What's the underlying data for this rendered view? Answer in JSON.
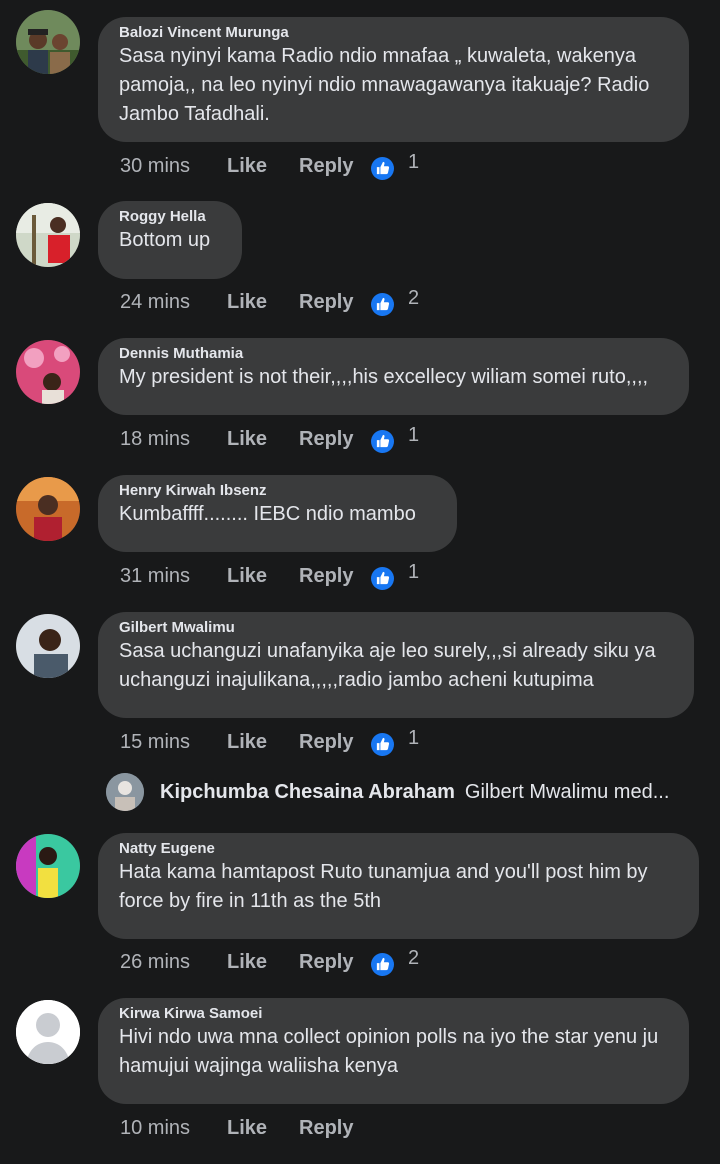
{
  "labels": {
    "like": "Like",
    "reply": "Reply"
  },
  "comments": [
    {
      "author": "Balozi Vincent Murunga",
      "text": "Sasa nyinyi kama Radio ndio mnafaa „ kuwaleta, wakenya pamoja,, na leo nyinyi ndio mnawagawanya itakuaje? Radio Jambo Tafadhali.",
      "time": "30 mins",
      "reactions": "1"
    },
    {
      "author": "Roggy Hella",
      "text": "Bottom up",
      "time": "24 mins",
      "reactions": "2"
    },
    {
      "author": "Dennis Muthamia",
      "text": "My president is not their,,,,his excellecy wiliam somei ruto,,,,",
      "time": "18 mins",
      "reactions": "1"
    },
    {
      "author": "Henry Kirwah Ibsenz",
      "text": "Kumbaffff........ IEBC ndio mambo",
      "time": "31 mins",
      "reactions": "1"
    },
    {
      "author": "Gilbert Mwalimu",
      "text": "Sasa uchanguzi unafanyika aje leo surely,,,si already siku ya uchanguzi inajulikana,,,,,radio jambo acheni kutupima",
      "time": "15 mins",
      "reactions": "1",
      "reply_preview": {
        "author": "Kipchumba Chesaina Abraham",
        "text": "Gilbert Mwalimu med..."
      }
    },
    {
      "author": "Natty Eugene",
      "text": "Hata kama hamtapost Ruto tunamjua and you'll post him by force by fire in 11th as the 5th",
      "time": "26 mins",
      "reactions": "2"
    },
    {
      "author": "Kirwa Kirwa Samoei",
      "text": "Hivi ndo uwa mna collect opinion polls na iyo the star yenu ju hamujui wajinga waliisha kenya",
      "time": "10 mins",
      "reactions": ""
    }
  ],
  "icons": {
    "reaction": "thumbs-up-icon",
    "avatar_default": "default-avatar-icon"
  },
  "colors": {
    "background": "#18191a",
    "bubble": "#3a3b3c",
    "like_reaction": "#1877f2",
    "secondary_text": "#b0b3b8"
  }
}
